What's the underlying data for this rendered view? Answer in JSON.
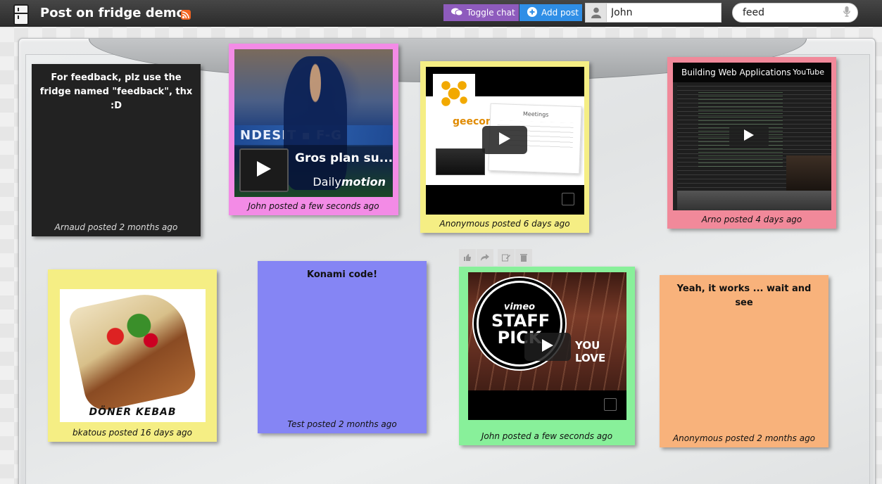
{
  "header": {
    "title": "Post on fridge demo",
    "toggle_chat_label": "Toggle chat",
    "add_post_label": "Add post",
    "user_name": "John",
    "search_value": "feed"
  },
  "colors": {
    "toggle_chat": "#8e5bbd",
    "add_post": "#2f8ee6",
    "note_black": "#222222",
    "note_pink": "#f38be6",
    "note_yellow": "#f5ee84",
    "note_red": "#f1899a",
    "note_blue": "#8585f4",
    "note_green": "#88f09a",
    "note_orange": "#f8b27b"
  },
  "posts": [
    {
      "text": "For feedback, plz use the fridge named \"feedback\", thx :D",
      "author": "Arnaud posted 2 months ago"
    },
    {
      "video_title": "Gros plan su...",
      "video_brand_a": "Daily",
      "video_brand_b": "motion",
      "author": "John posted a few seconds ago"
    },
    {
      "slide_heading": "Meetings",
      "slide_logo": "geecon",
      "author": "Anonymous posted 6 days ago"
    },
    {
      "video_title": "Building Web Applications",
      "video_brand": "YouTube",
      "author": "Arno posted 4 days ago"
    },
    {
      "image_caption": "DÖNER KEBAB",
      "author": "bkatous posted 16 days ago"
    },
    {
      "text": "Konami code!",
      "author": "Test posted 2 months ago"
    },
    {
      "badge_top": "vimeo",
      "badge_main": "STAFF PICK",
      "overlay_text": "YOU LOVE",
      "author": "John posted a few seconds ago"
    },
    {
      "text": "Yeah, it works ... wait and see",
      "author": "Anonymous posted 2 months ago"
    }
  ],
  "icons": [
    "fridge-logo-icon",
    "rss-icon",
    "chat-icon",
    "plus-circle-icon",
    "user-icon",
    "mic-icon",
    "play-icon",
    "fullscreen-icon",
    "like-icon",
    "share-icon",
    "edit-icon",
    "trash-icon"
  ]
}
